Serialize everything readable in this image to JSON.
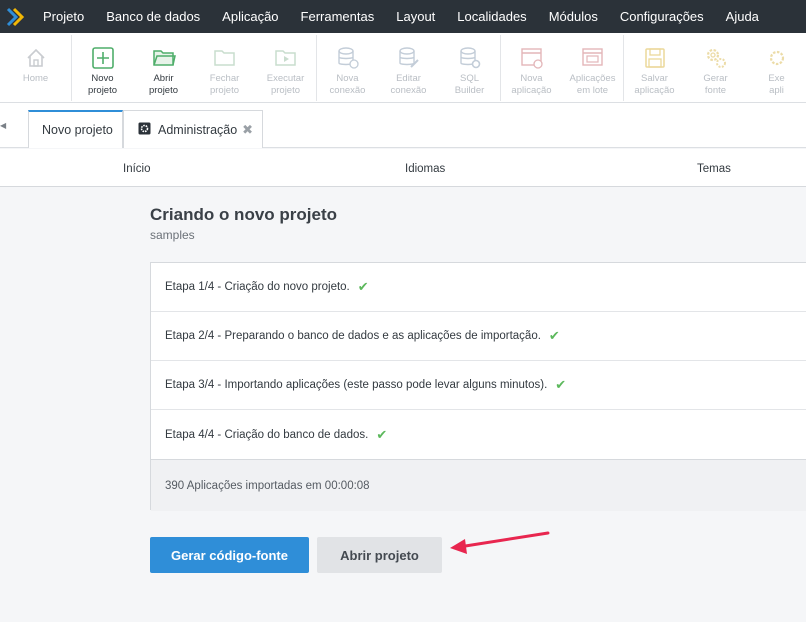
{
  "menu": [
    "Projeto",
    "Banco de dados",
    "Aplicação",
    "Ferramentas",
    "Layout",
    "Localidades",
    "Módulos",
    "Configurações",
    "Ajuda"
  ],
  "toolbar": {
    "home": "Home",
    "novo_l1": "Novo",
    "novo_l2": "projeto",
    "abrir_l1": "Abrir",
    "abrir_l2": "projeto",
    "fechar_l1": "Fechar",
    "fechar_l2": "projeto",
    "executar_l1": "Executar",
    "executar_l2": "projeto",
    "nova_conexao_l1": "Nova",
    "nova_conexao_l2": "conexão",
    "editar_conexao_l1": "Editar",
    "editar_conexao_l2": "conexão",
    "sql_l1": "SQL",
    "sql_l2": "Builder",
    "nova_app_l1": "Nova",
    "nova_app_l2": "aplicação",
    "apps_lote_l1": "Aplicações",
    "apps_lote_l2": "em lote",
    "salvar_l1": "Salvar",
    "salvar_l2": "aplicação",
    "gerar_l1": "Gerar",
    "gerar_l2": "fonte",
    "exec_l1": "Exe",
    "exec_l2": "apli"
  },
  "tabs": {
    "novo": "Novo projeto",
    "admin": "Administração"
  },
  "steps": [
    "Início",
    "Idiomas",
    "Temas"
  ],
  "main": {
    "title": "Criando o novo projeto",
    "subtitle": "samples",
    "rows": [
      "Etapa 1/4 - Criação do novo projeto.",
      "Etapa 2/4 - Preparando o banco de dados e as aplicações de importação.",
      "Etapa 3/4 - Importando aplicações (este passo pode levar alguns minutos).",
      "Etapa 4/4 - Criação do banco de dados."
    ],
    "check": "✔",
    "footer": "390 Aplicações importadas em 00:00:08",
    "btn_gerar": "Gerar código-fonte",
    "btn_abrir": "Abrir projeto"
  },
  "colors": {
    "menubar": "#2b3239",
    "accent": "#2f8ed8",
    "success": "#5cb85c",
    "arrow": "#e8264f"
  }
}
